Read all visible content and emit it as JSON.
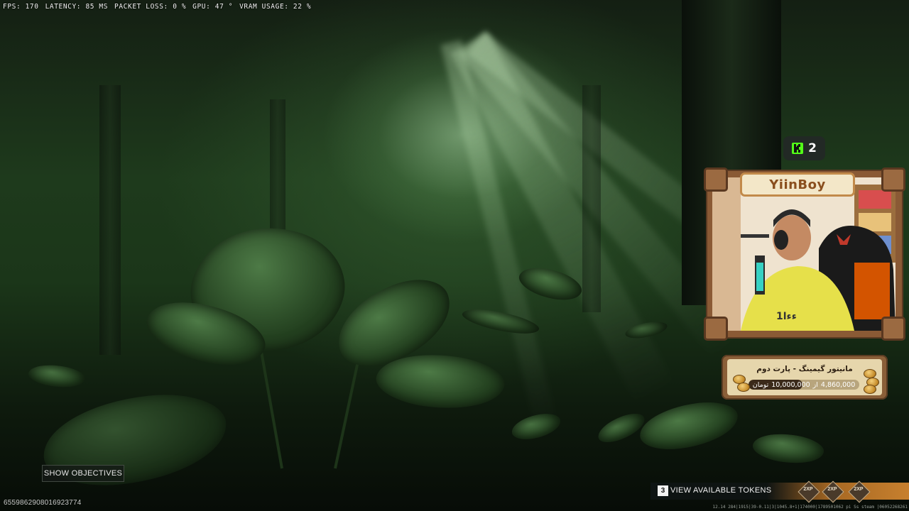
{
  "perf": {
    "fps": "FPS: 170",
    "latency": "LATENCY: 85 MS",
    "packet_loss": "PACKET LOSS: 0 %",
    "gpu": "GPU: 47 °",
    "vram": "VRAM USAGE: 22 %"
  },
  "kick": {
    "viewer_count": "2",
    "brand_color": "#53fc18"
  },
  "streamer": {
    "name": "YiinBoy"
  },
  "goal": {
    "title": "مانیتور گیمینگ - پارت دوم",
    "current": "4,860,000",
    "separator": "از",
    "target": "10,000,000",
    "currency": "تومان",
    "progress_fraction": 0.486
  },
  "hud": {
    "show_objectives": "SHOW OBJECTIVES",
    "session_id": "6559862908016923774",
    "token_key": "3",
    "view_tokens": "VIEW AVAILABLE TOKENS",
    "xp_badge": "2XP",
    "footer_coords": "12.14 284|1915|39-0.11|3|1045.8+1|174000|1789501062 pi Ss steam |06052268261"
  },
  "colors": {
    "accent_wood": "#8a5a35",
    "name_text": "#8a4f1e",
    "kick_bg": "#23282b"
  }
}
